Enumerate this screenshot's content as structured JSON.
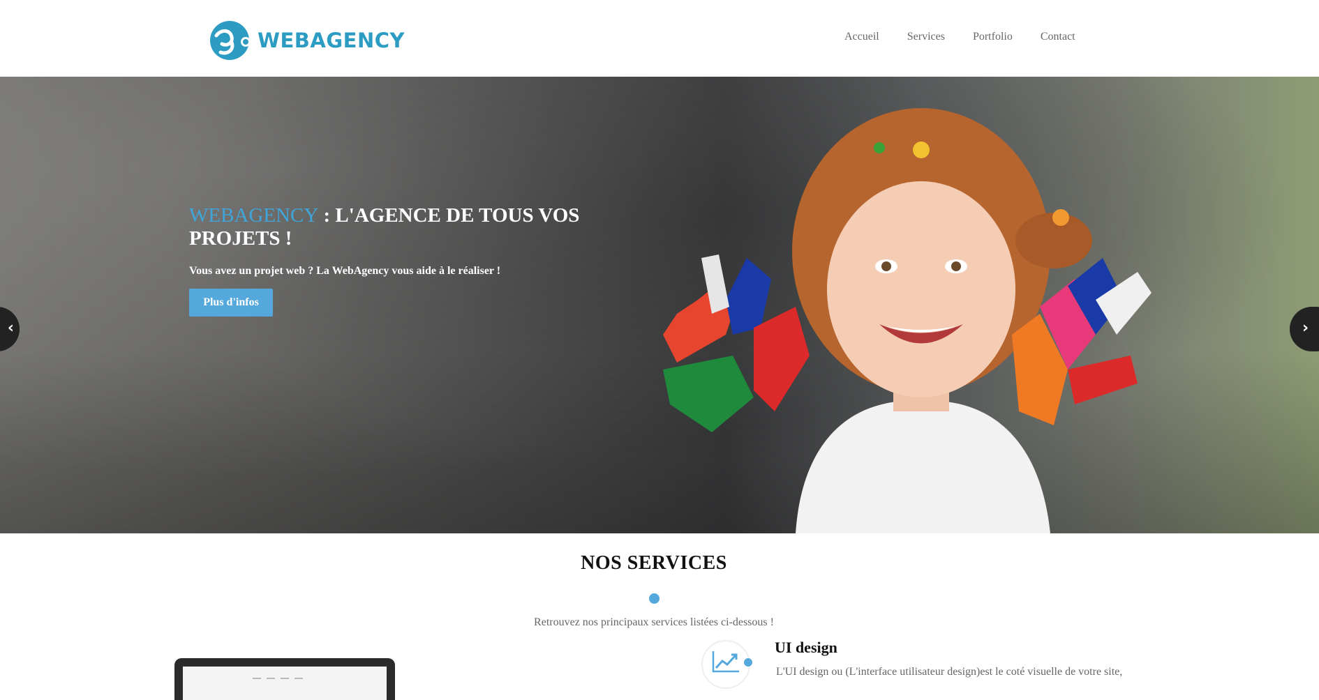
{
  "header": {
    "logo_text": "WEBAGENCY",
    "nav": [
      {
        "label": "Accueil"
      },
      {
        "label": "Services"
      },
      {
        "label": "Portfolio"
      },
      {
        "label": "Contact"
      }
    ]
  },
  "hero": {
    "title_accent": "WEBAGENCY",
    "title_rest": " : L'AGENCE DE TOUS VOS PROJETS !",
    "subtitle": "Vous avez un projet web ? La WebAgency vous aide à le réaliser !",
    "button_label": "Plus d'infos",
    "prev_icon": "chevron-left-icon",
    "next_icon": "chevron-right-icon"
  },
  "services": {
    "title": "NOS SERVICES",
    "intro": "Retrouvez nos principaux services listées ci-dessous !",
    "items": [
      {
        "title": "UI design",
        "text": "L'UI design ou (L'interface utilisateur design)est le coté visuelle de votre site,",
        "icon": "chart-trend-icon"
      }
    ]
  },
  "colors": {
    "brand": "#2d9cc2",
    "accent": "#54a8dc",
    "nav_text": "#666666"
  }
}
